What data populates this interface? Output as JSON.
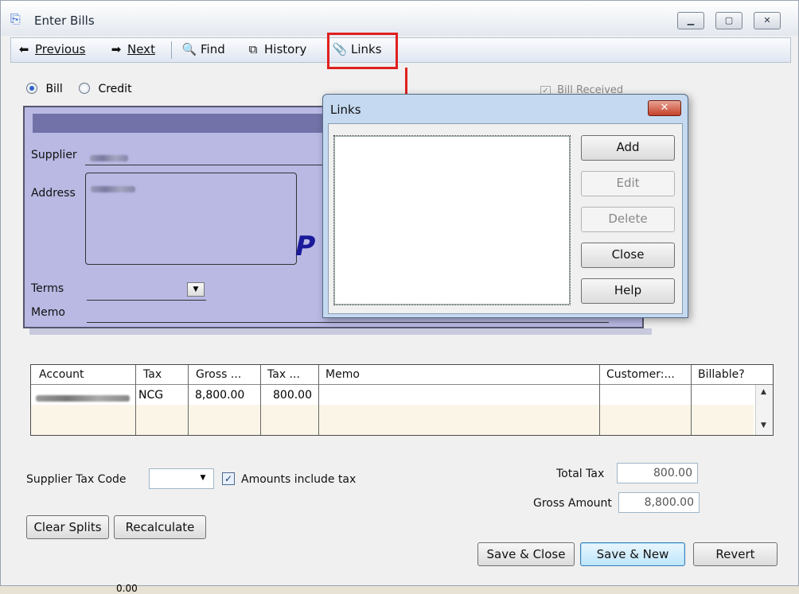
{
  "window": {
    "title": "Enter Bills",
    "controls": [
      "—",
      "▢",
      "✕"
    ]
  },
  "toolbar": {
    "previous": "Previous",
    "next": "Next",
    "find": "Find",
    "history": "History",
    "links": "Links"
  },
  "form": {
    "bill_label": "Bill",
    "credit_label": "Credit",
    "bill_received": "Bill Received",
    "supplier_label": "Supplier",
    "address_label": "Address",
    "terms_label": "Terms",
    "memo_label": "Memo"
  },
  "grid": {
    "headers": [
      "Account",
      "Tax",
      "Gross ...",
      "Tax ...",
      "Memo",
      "Customer:...",
      "Billable?"
    ],
    "rows": [
      {
        "tax": "NCG",
        "gross": "8,800.00",
        "tax_amount": "800.00",
        "memo": "",
        "customer": "",
        "billable": ""
      }
    ]
  },
  "bottom": {
    "supplier_tax_code_label": "Supplier Tax Code",
    "amounts_include_tax_label": "Amounts include tax",
    "amounts_include_tax_checked": true,
    "total_tax_label": "Total Tax",
    "total_tax_value": "800.00",
    "gross_amount_label": "Gross Amount",
    "gross_amount_value": "8,800.00",
    "clear_splits": "Clear Splits",
    "recalculate": "Recalculate",
    "save_close": "Save & Close",
    "save_new": "Save & New",
    "revert": "Revert",
    "footer_value": "0.00"
  },
  "links_dialog": {
    "title": "Links",
    "add": "Add",
    "edit": "Edit",
    "delete": "Delete",
    "close": "Close",
    "help": "Help"
  },
  "colors": {
    "highlight": "#e02020",
    "bill_panel": "#b9b9e4"
  }
}
